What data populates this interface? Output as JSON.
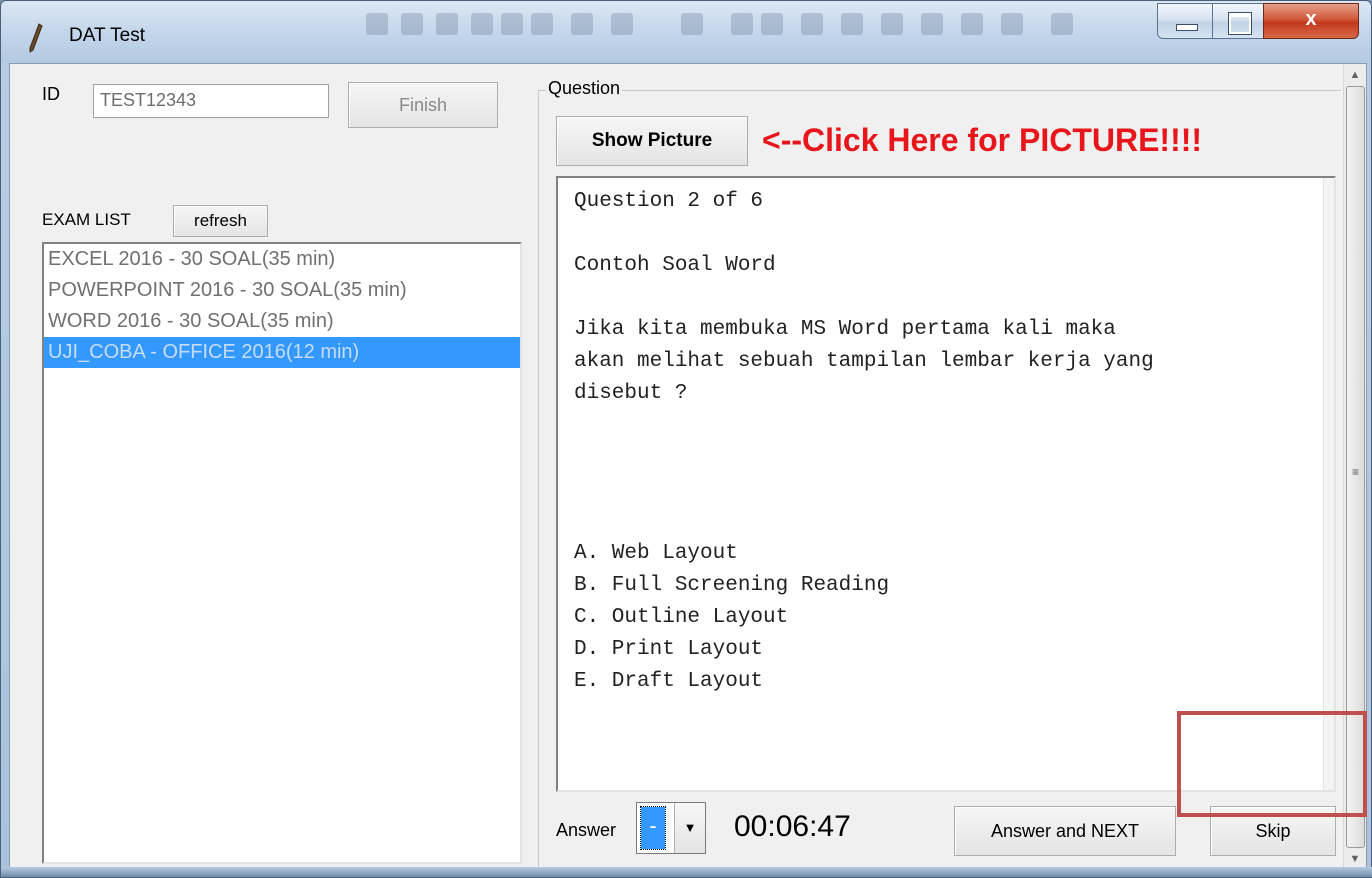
{
  "window": {
    "title": "DAT Test",
    "close_glyph": "x"
  },
  "left_panel": {
    "id_label": "ID",
    "id_value": "TEST12343",
    "finish_label": "Finish",
    "exam_list_label": "EXAM LIST",
    "refresh_label": "refresh",
    "exams": [
      {
        "label": "EXCEL 2016 - 30 SOAL(35 min)"
      },
      {
        "label": "POWERPOINT 2016 - 30 SOAL(35 min)"
      },
      {
        "label": "WORD 2016 - 30 SOAL(35 min)"
      },
      {
        "label": "UJI_COBA - OFFICE 2016(12 min)",
        "selected": true
      }
    ]
  },
  "question_panel": {
    "group_label": "Question",
    "show_picture_label": "Show Picture",
    "click_here_text": "<--Click Here for PICTURE!!!!",
    "question_text": "Question 2 of 6\n\nContoh Soal Word\n\nJika kita membuka MS Word pertama kali maka\nakan melihat sebuah tampilan lembar kerja yang\ndisebut ?\n\n\n\n\nA. Web Layout\nB. Full Screening Reading\nC. Outline Layout\nD. Print Layout\nE. Draft Layout",
    "answer_label": "Answer",
    "answer_value": "-",
    "timer": "00:06:47",
    "answer_next_label": "Answer and NEXT",
    "skip_label": "Skip"
  },
  "colors": {
    "selected_bg": "#3399ff",
    "click_here_red": "#e8161b",
    "highlight_border": "#c0504d"
  },
  "icons": {
    "app_icon": "pen-icon",
    "scroll_up": "chevron-up-icon",
    "scroll_down": "chevron-down-icon",
    "dropdown": "chevron-down-icon"
  }
}
